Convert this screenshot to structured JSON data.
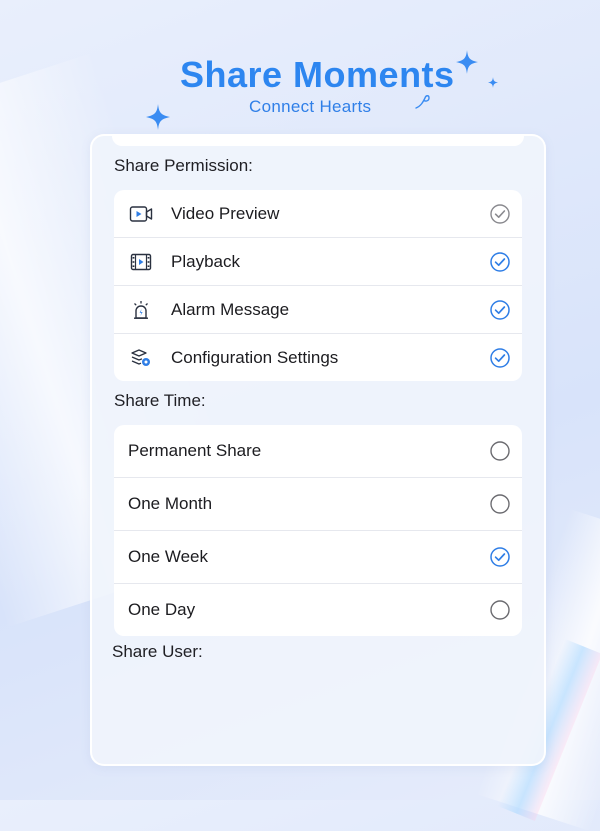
{
  "header": {
    "title": "Share Moments",
    "subtitle": "Connect Hearts"
  },
  "sections": {
    "permission_label": "Share Permission:",
    "time_label": "Share Time:",
    "user_label": "Share User:"
  },
  "permissions": [
    {
      "label": "Video Preview",
      "icon": "video-preview-icon",
      "checked": true,
      "enabled": false
    },
    {
      "label": "Playback",
      "icon": "film-strip-icon",
      "checked": true,
      "enabled": true
    },
    {
      "label": "Alarm Message",
      "icon": "alarm-siren-icon",
      "checked": true,
      "enabled": true
    },
    {
      "label": "Configuration Settings",
      "icon": "config-settings-icon",
      "checked": true,
      "enabled": true
    }
  ],
  "share_time": [
    {
      "label": "Permanent Share",
      "selected": false
    },
    {
      "label": "One Month",
      "selected": false
    },
    {
      "label": "One Week",
      "selected": true
    },
    {
      "label": "One Day",
      "selected": false
    }
  ],
  "colors": {
    "accent": "#2d86f0",
    "check_blue": "#2f7ee6",
    "check_disabled": "#8a8a8f",
    "radio_grey": "#6b6b70"
  }
}
